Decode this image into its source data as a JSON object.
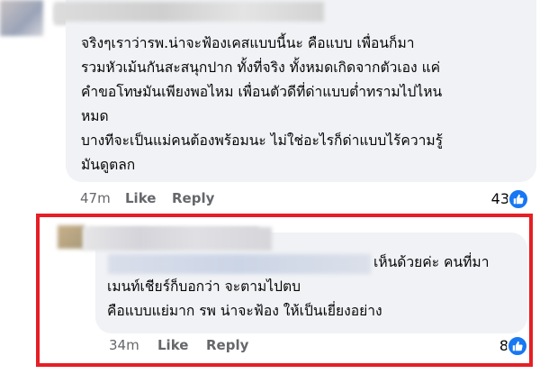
{
  "comment_1": {
    "lines": [
      "จริงๆเราว่ารพ.น่าจะฟ้องเคสแบบนี้นะ คือแบบ เพื่อนก็มา",
      "รวมหัวเม้นกันสะสนุกปาก ทั้งที่จริง ทั้งหมดเกิดจากตัวเอง แค่",
      "คำขอโทษมันเพียงพอไหม เพื่อนตัวดีที่ด่าแบบต่ำทรามไปไหน",
      "หมด",
      "บางทีจะเป็นแม่คนต้องพร้อมนะ ไม่ใช่อะไรก็ด่าแบบไร้ความรู้",
      "มันดูตลก"
    ],
    "time": "47m",
    "like_label": "Like",
    "reply_label": "Reply",
    "reaction_count": "43",
    "reaction_icon": "thumbs-up-icon"
  },
  "comment_2": {
    "lines": [
      "เห็นด้วยค่ะ คนที่มา",
      "เมนท์เชียร์ก็บอกว่า จะตามไปตบ",
      "คือแบบแย่มาก รพ น่าจะฟ้อง ให้เป็นเยี่ยงอย่าง"
    ],
    "time": "34m",
    "like_label": "Like",
    "reply_label": "Reply",
    "reaction_count": "8",
    "reaction_icon": "thumbs-up-icon"
  },
  "colors": {
    "bubble": "#f0f2f5",
    "meta_text": "#65676b",
    "like_blue": "#1877f2",
    "highlight_frame": "#e61e25"
  }
}
